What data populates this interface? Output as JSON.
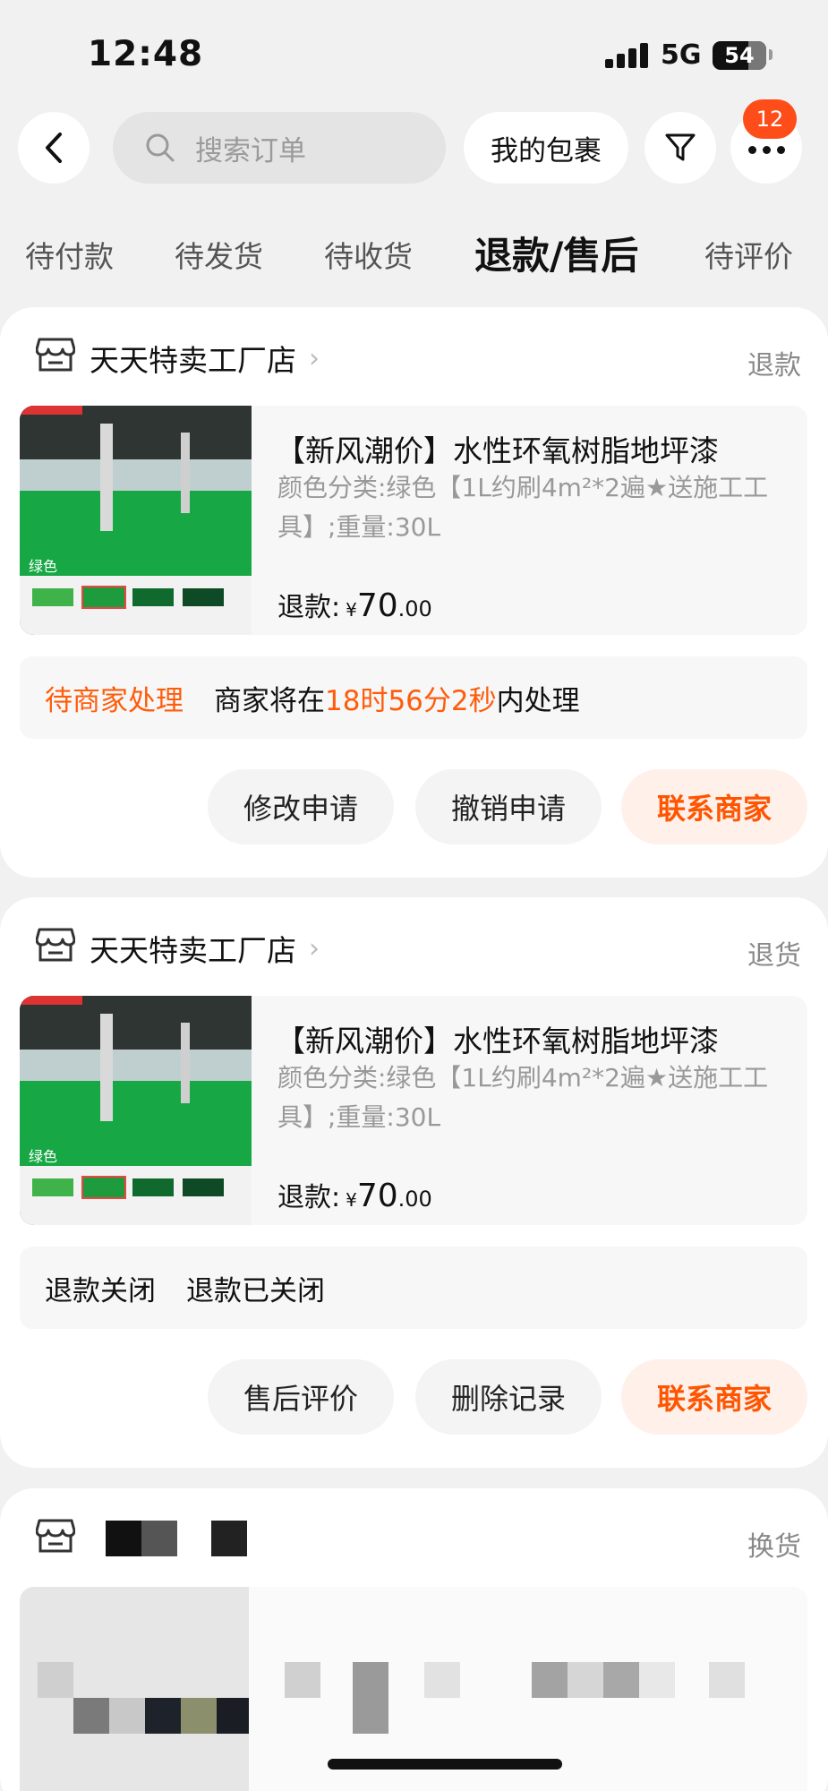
{
  "status_bar": {
    "time": "12:48",
    "network": "5G",
    "battery": "54"
  },
  "header": {
    "search_placeholder": "搜索订单",
    "parcel_button": "我的包裹",
    "more_badge": "12"
  },
  "tabs": [
    {
      "label": "待付款",
      "active": false
    },
    {
      "label": "待发货",
      "active": false
    },
    {
      "label": "待收货",
      "active": false
    },
    {
      "label": "退款/售后",
      "active": true
    },
    {
      "label": "待评价",
      "active": false
    }
  ],
  "orders": [
    {
      "store": "天天特卖工厂店",
      "type_tag": "退款",
      "item": {
        "title": "【新风潮价】水性环氧树脂地坪漆",
        "spec": "颜色分类:绿色【1L约刷4m²*2遍★送施工工具】;重量:30L",
        "price_label": "退款:",
        "currency": "¥",
        "price_int": "70",
        "price_dec": ".00",
        "image_label": "绿色"
      },
      "status_title": "待商家处理",
      "status_prefix": "商家将在",
      "status_countdown": "18时56分2秒",
      "status_suffix": "内处理",
      "actions": [
        "修改申请",
        "撤销申请",
        "联系商家"
      ]
    },
    {
      "store": "天天特卖工厂店",
      "type_tag": "退货",
      "item": {
        "title": "【新风潮价】水性环氧树脂地坪漆",
        "spec": "颜色分类:绿色【1L约刷4m²*2遍★送施工工具】;重量:30L",
        "price_label": "退款:",
        "currency": "¥",
        "price_int": "70",
        "price_dec": ".00",
        "image_label": "绿色"
      },
      "status_title": "退款关闭",
      "status_detail": "退款已关闭",
      "actions": [
        "售后评价",
        "删除记录",
        "联系商家"
      ]
    },
    {
      "type_tag": "换货"
    }
  ],
  "colors": {
    "accent": "#ff5c0a",
    "badge": "#ff4d1a",
    "background": "#f1f1f1"
  }
}
